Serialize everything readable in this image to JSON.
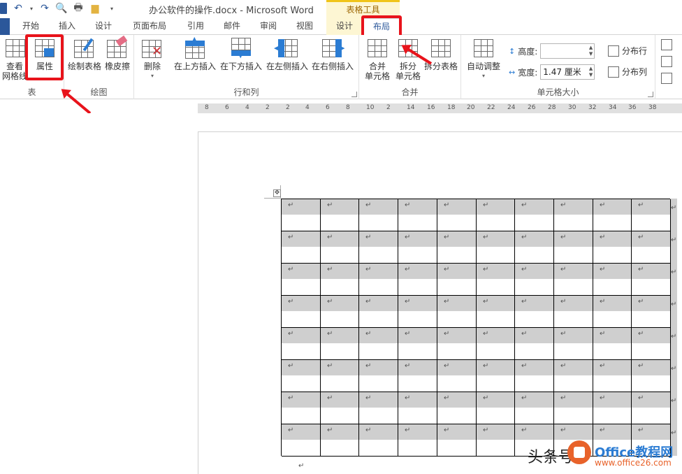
{
  "titlebar": {
    "document_title": "办公软件的操作.docx - Microsoft Word",
    "context_group": "表格工具"
  },
  "tabs": [
    {
      "label": "开始"
    },
    {
      "label": "插入"
    },
    {
      "label": "设计"
    },
    {
      "label": "页面布局"
    },
    {
      "label": "引用"
    },
    {
      "label": "邮件"
    },
    {
      "label": "审阅"
    },
    {
      "label": "视图"
    },
    {
      "label": "设计"
    },
    {
      "label": "布局"
    }
  ],
  "ribbon": {
    "group_table": {
      "label": "表",
      "view_gridlines": "查看\n网格线",
      "properties": "属性"
    },
    "group_draw": {
      "label": "绘图",
      "draw_table": "绘制表格",
      "eraser": "橡皮擦"
    },
    "group_rows_cols": {
      "label": "行和列",
      "delete": "删除",
      "insert_above": "在上方插入",
      "insert_below": "在下方插入",
      "insert_left": "在左侧插入",
      "insert_right": "在右侧插入"
    },
    "group_merge": {
      "label": "合并",
      "merge_cells_l1": "合并",
      "merge_cells_l2": "单元格",
      "split_cells_l1": "拆分",
      "split_cells_l2": "单元格",
      "split_table": "拆分表格"
    },
    "group_cell_size": {
      "label": "单元格大小",
      "autofit": "自动调整",
      "height_label": "高度:",
      "height_value": "",
      "width_label": "宽度:",
      "width_value": "1.47 厘米",
      "distribute_rows": "分布行",
      "distribute_cols": "分布列"
    }
  },
  "ruler": {
    "ticks": [
      "8",
      "6",
      "4",
      "2",
      "2",
      "4",
      "6",
      "8",
      "10",
      "2",
      "14",
      "16",
      "18",
      "20",
      "22",
      "24",
      "26",
      "28",
      "30",
      "32",
      "34",
      "36",
      "38"
    ]
  },
  "document": {
    "paragraph_mark": "↵",
    "rows": 8,
    "cols": 10
  },
  "watermark": {
    "text": "头条号",
    "brand": "Office教程网",
    "url": "www.office26.com"
  },
  "colors": {
    "word_blue": "#2b579a",
    "highlight_red": "#e8131b",
    "context_yellow": "#fdf6d3"
  }
}
